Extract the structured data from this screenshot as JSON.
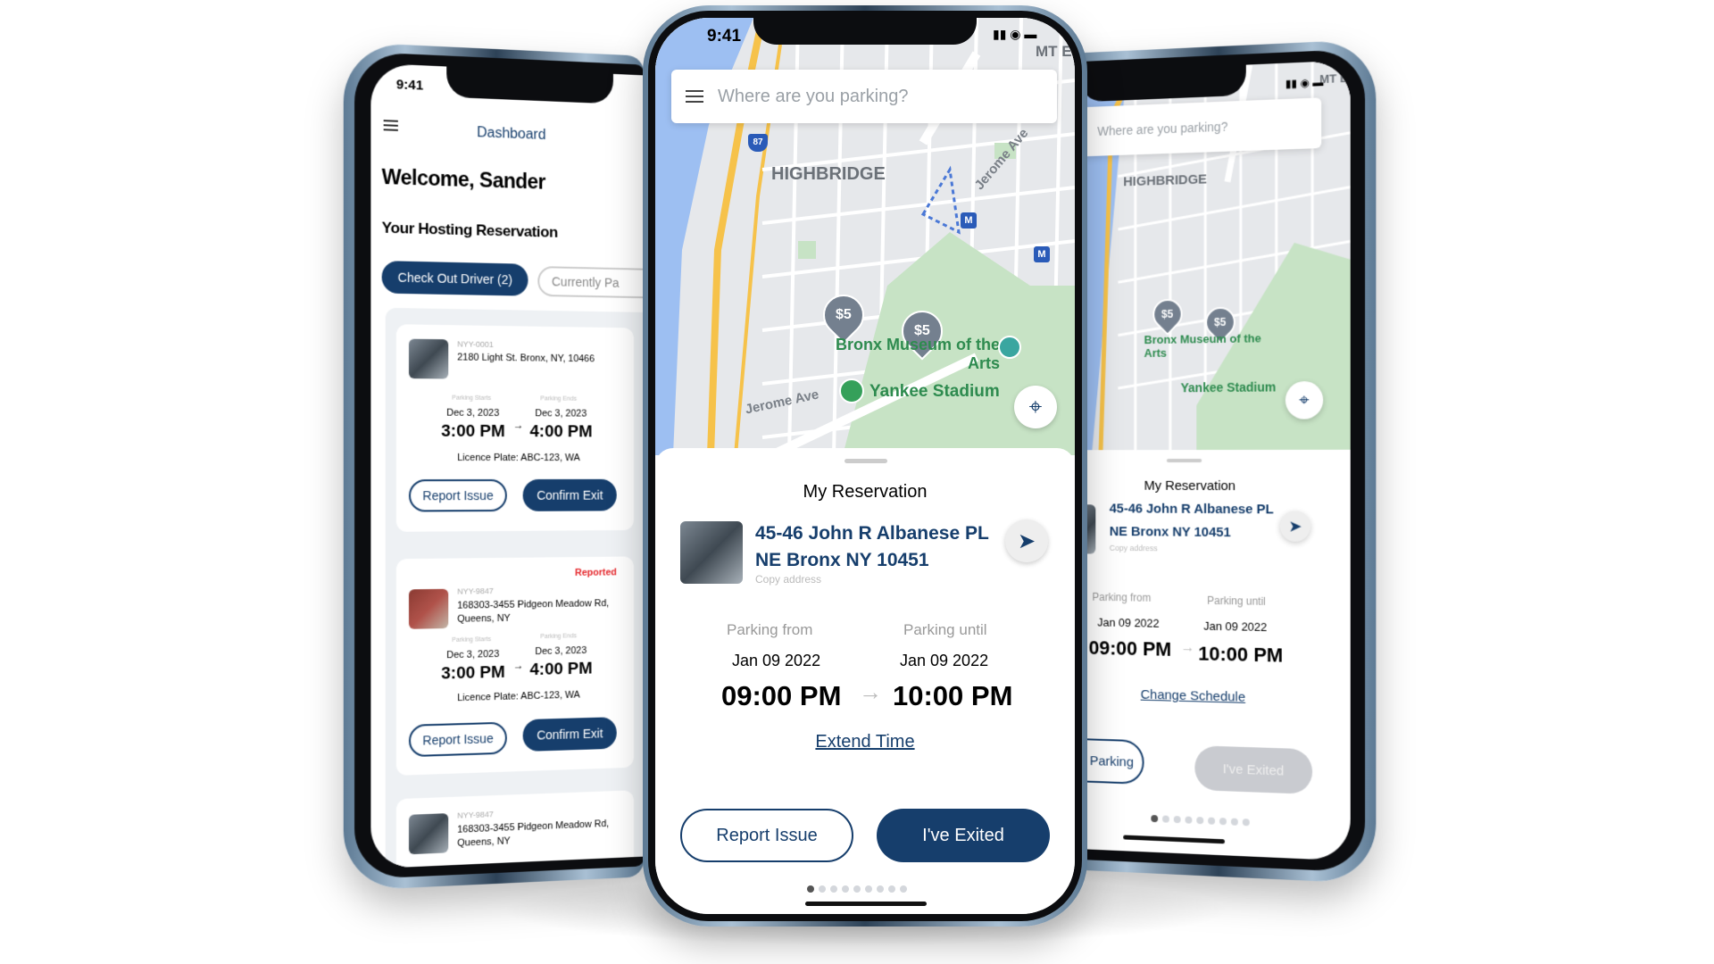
{
  "colors": {
    "brand": "#163e6c",
    "reported": "#e5262b",
    "disabled": "#c9cbd0",
    "park": "#c7e3c5",
    "water": "#9dbff2",
    "highway": "#f6c24a"
  },
  "status_time": "9:41",
  "map": {
    "search_placeholder": "Where are you parking?",
    "neighborhood": "HIGHBRIDGE",
    "street": "Jerome Ave",
    "street2": "Jerome Ave",
    "museum": "Bronx Museum of the Arts",
    "stadium": "Yankee Stadium",
    "price_pins": [
      "$5",
      "$5"
    ],
    "metro_badge": "M",
    "highway_shield": "87",
    "corner": "MT E"
  },
  "dashboard": {
    "title": "Dashboard",
    "welcome": "Welcome, Sander",
    "section": "Your Hosting Reservation",
    "tabs": [
      {
        "label": "Check Out Driver (2)",
        "active": true
      },
      {
        "label": "Currently Pa",
        "active": false
      }
    ],
    "cards": [
      {
        "id": "NYY-0001",
        "address": "2180 Light St. Bronx, NY, 10466",
        "status": "",
        "start_label": "Parking Starts",
        "end_label": "Parking Ends",
        "start_date": "Dec 3, 2023",
        "end_date": "Dec 3, 2023",
        "start_time": "3:00 PM",
        "end_time": "4:00 PM",
        "plate": "Licence Plate: ABC-123, WA",
        "report": "Report Issue",
        "confirm": "Confirm Exit"
      },
      {
        "id": "NYY-9847",
        "address": "168303-3455  Pidgeon Meadow Rd, Queens, NY",
        "status": "Reported",
        "start_label": "Parking Starts",
        "end_label": "Parking Ends",
        "start_date": "Dec 3, 2023",
        "end_date": "Dec 3, 2023",
        "start_time": "3:00 PM",
        "end_time": "4:00 PM",
        "plate": "Licence Plate: ABC-123, WA",
        "report": "Report Issue",
        "confirm": "Confirm Exit"
      },
      {
        "id": "NYY-9847",
        "address": "168303-3455  Pidgeon Meadow Rd, Queens, NY"
      }
    ]
  },
  "reservation": {
    "title": "My Reservation",
    "address_line1": "45-46 John R Albanese PL",
    "address_line2": "NE Bronx NY 10451",
    "copy": "Copy address",
    "from_label": "Parking from",
    "until_label": "Parking until",
    "from_date": "Jan 09 2022",
    "until_date": "Jan 09 2022",
    "from_time": "09:00 PM",
    "until_time": "10:00 PM",
    "extend": "Extend Time",
    "report": "Report Issue",
    "exited": "I've Exited",
    "page_count": 9,
    "page_active": 1
  },
  "reservation_alt": {
    "title": "My Reservation",
    "address_line1": "45-46 John R Albanese PL",
    "address_line2": "NE Bronx NY 10451",
    "copy": "Copy address",
    "from_label": "Parking from",
    "until_label": "Parking until",
    "from_date": "Jan 09 2022",
    "until_date": "Jan 09 2022",
    "from_time": "09:00 PM",
    "until_time": "10:00 PM",
    "change": "Change Schedule",
    "cancel": "ancel Parking",
    "exited": "I've Exited"
  }
}
